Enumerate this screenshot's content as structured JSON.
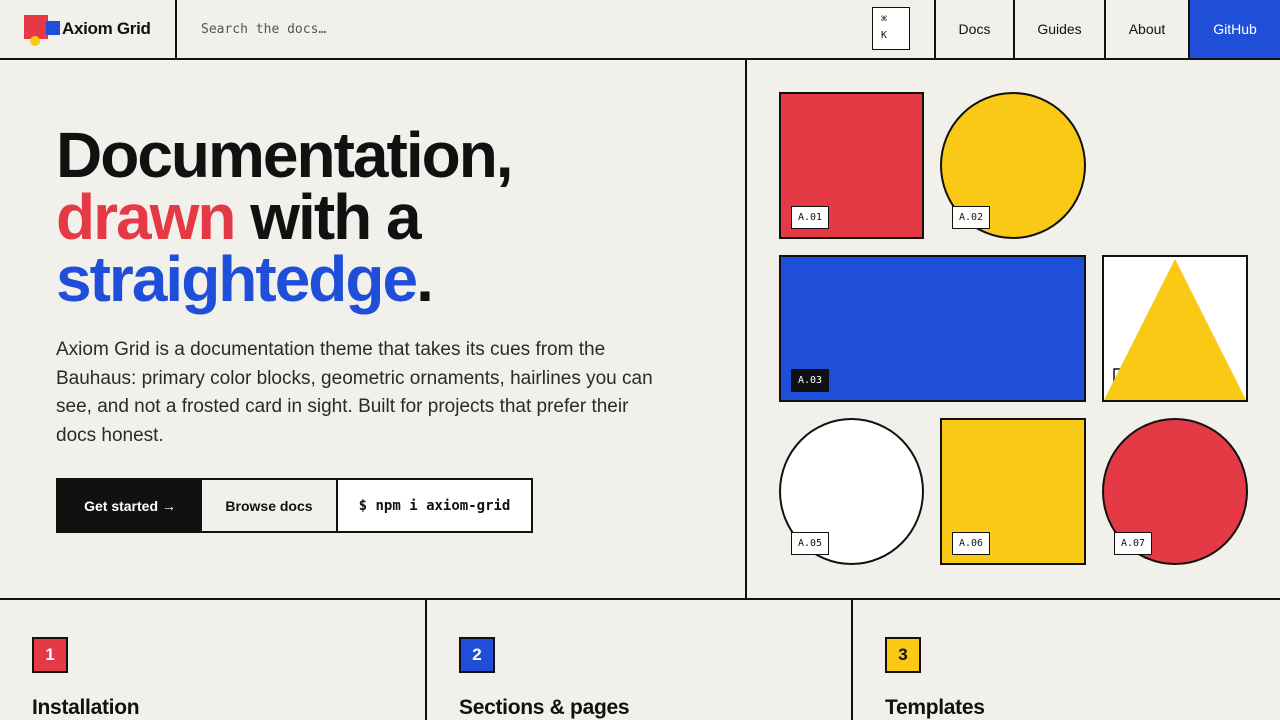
{
  "brand": {
    "name": "Axiom Grid"
  },
  "search": {
    "placeholder": "Search the docs…",
    "shortcut_line1": "⌘",
    "shortcut_line2": "K"
  },
  "nav": {
    "docs": "Docs",
    "guides": "Guides",
    "about": "About",
    "github": "GitHub"
  },
  "hero": {
    "line1": "Documentation,",
    "line2_red": "drawn",
    "line2_rest": " with a",
    "line3_blue": "straightedge",
    "line3_dot": ".",
    "lede": "Axiom Grid is a documentation theme that takes its cues from the Bauhaus: primary color blocks, geometric ornaments, hairlines you can see, and not a frosted card in sight. Built for projects that prefer their docs honest.",
    "btn_start": "Get started →",
    "btn_browse": "Browse docs",
    "btn_npm": "$ npm i axiom-grid"
  },
  "shapes": {
    "a01": "A.01",
    "a02": "A.02",
    "a03": "A.03",
    "a05": "A.05",
    "a06": "A.06",
    "a07": "A.07"
  },
  "cards": [
    {
      "num": "1",
      "title": "Installation"
    },
    {
      "num": "2",
      "title": "Sections & pages"
    },
    {
      "num": "3",
      "title": "Templates"
    }
  ],
  "colors": {
    "red": "#e63946",
    "yellow": "#f9c916",
    "blue": "#1f4fd8",
    "ink": "#111111",
    "paper": "#f2f0eb"
  }
}
